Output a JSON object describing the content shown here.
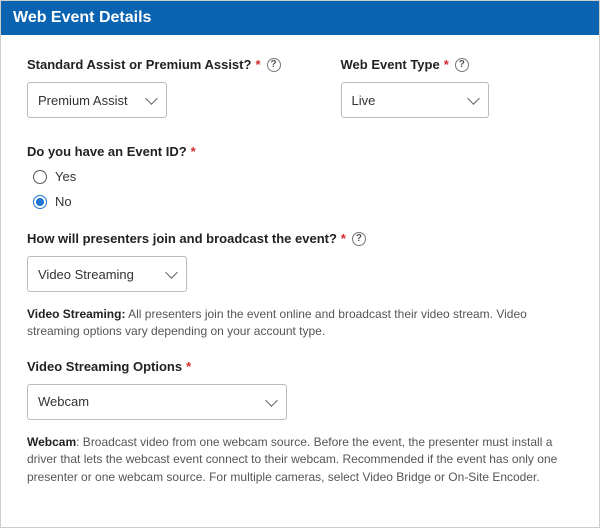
{
  "header": {
    "title": "Web Event Details"
  },
  "assist": {
    "label": "Standard Assist or Premium Assist?",
    "value": "Premium Assist"
  },
  "eventType": {
    "label": "Web Event Type",
    "value": "Live"
  },
  "eventId": {
    "label": "Do you have an Event ID?",
    "options": {
      "yes": "Yes",
      "no": "No"
    },
    "selected": "no"
  },
  "joinMethod": {
    "label": "How will presenters join and broadcast the event?",
    "value": "Video Streaming"
  },
  "vsDesc": {
    "term": "Video Streaming:",
    "text": " All presenters join the event online and broadcast their video stream. Video streaming options vary depending on your account type."
  },
  "vsOptions": {
    "label": "Video Streaming Options",
    "value": "Webcam"
  },
  "webcamDesc": {
    "term": "Webcam",
    "text": ": Broadcast video from one webcam source. Before the event, the presenter must install a driver that lets the webcast event connect to their webcam. Recommended if the event has only one presenter or one webcam source. For multiple cameras, select Video Bridge or On-Site Encoder."
  },
  "asterisk": "*"
}
